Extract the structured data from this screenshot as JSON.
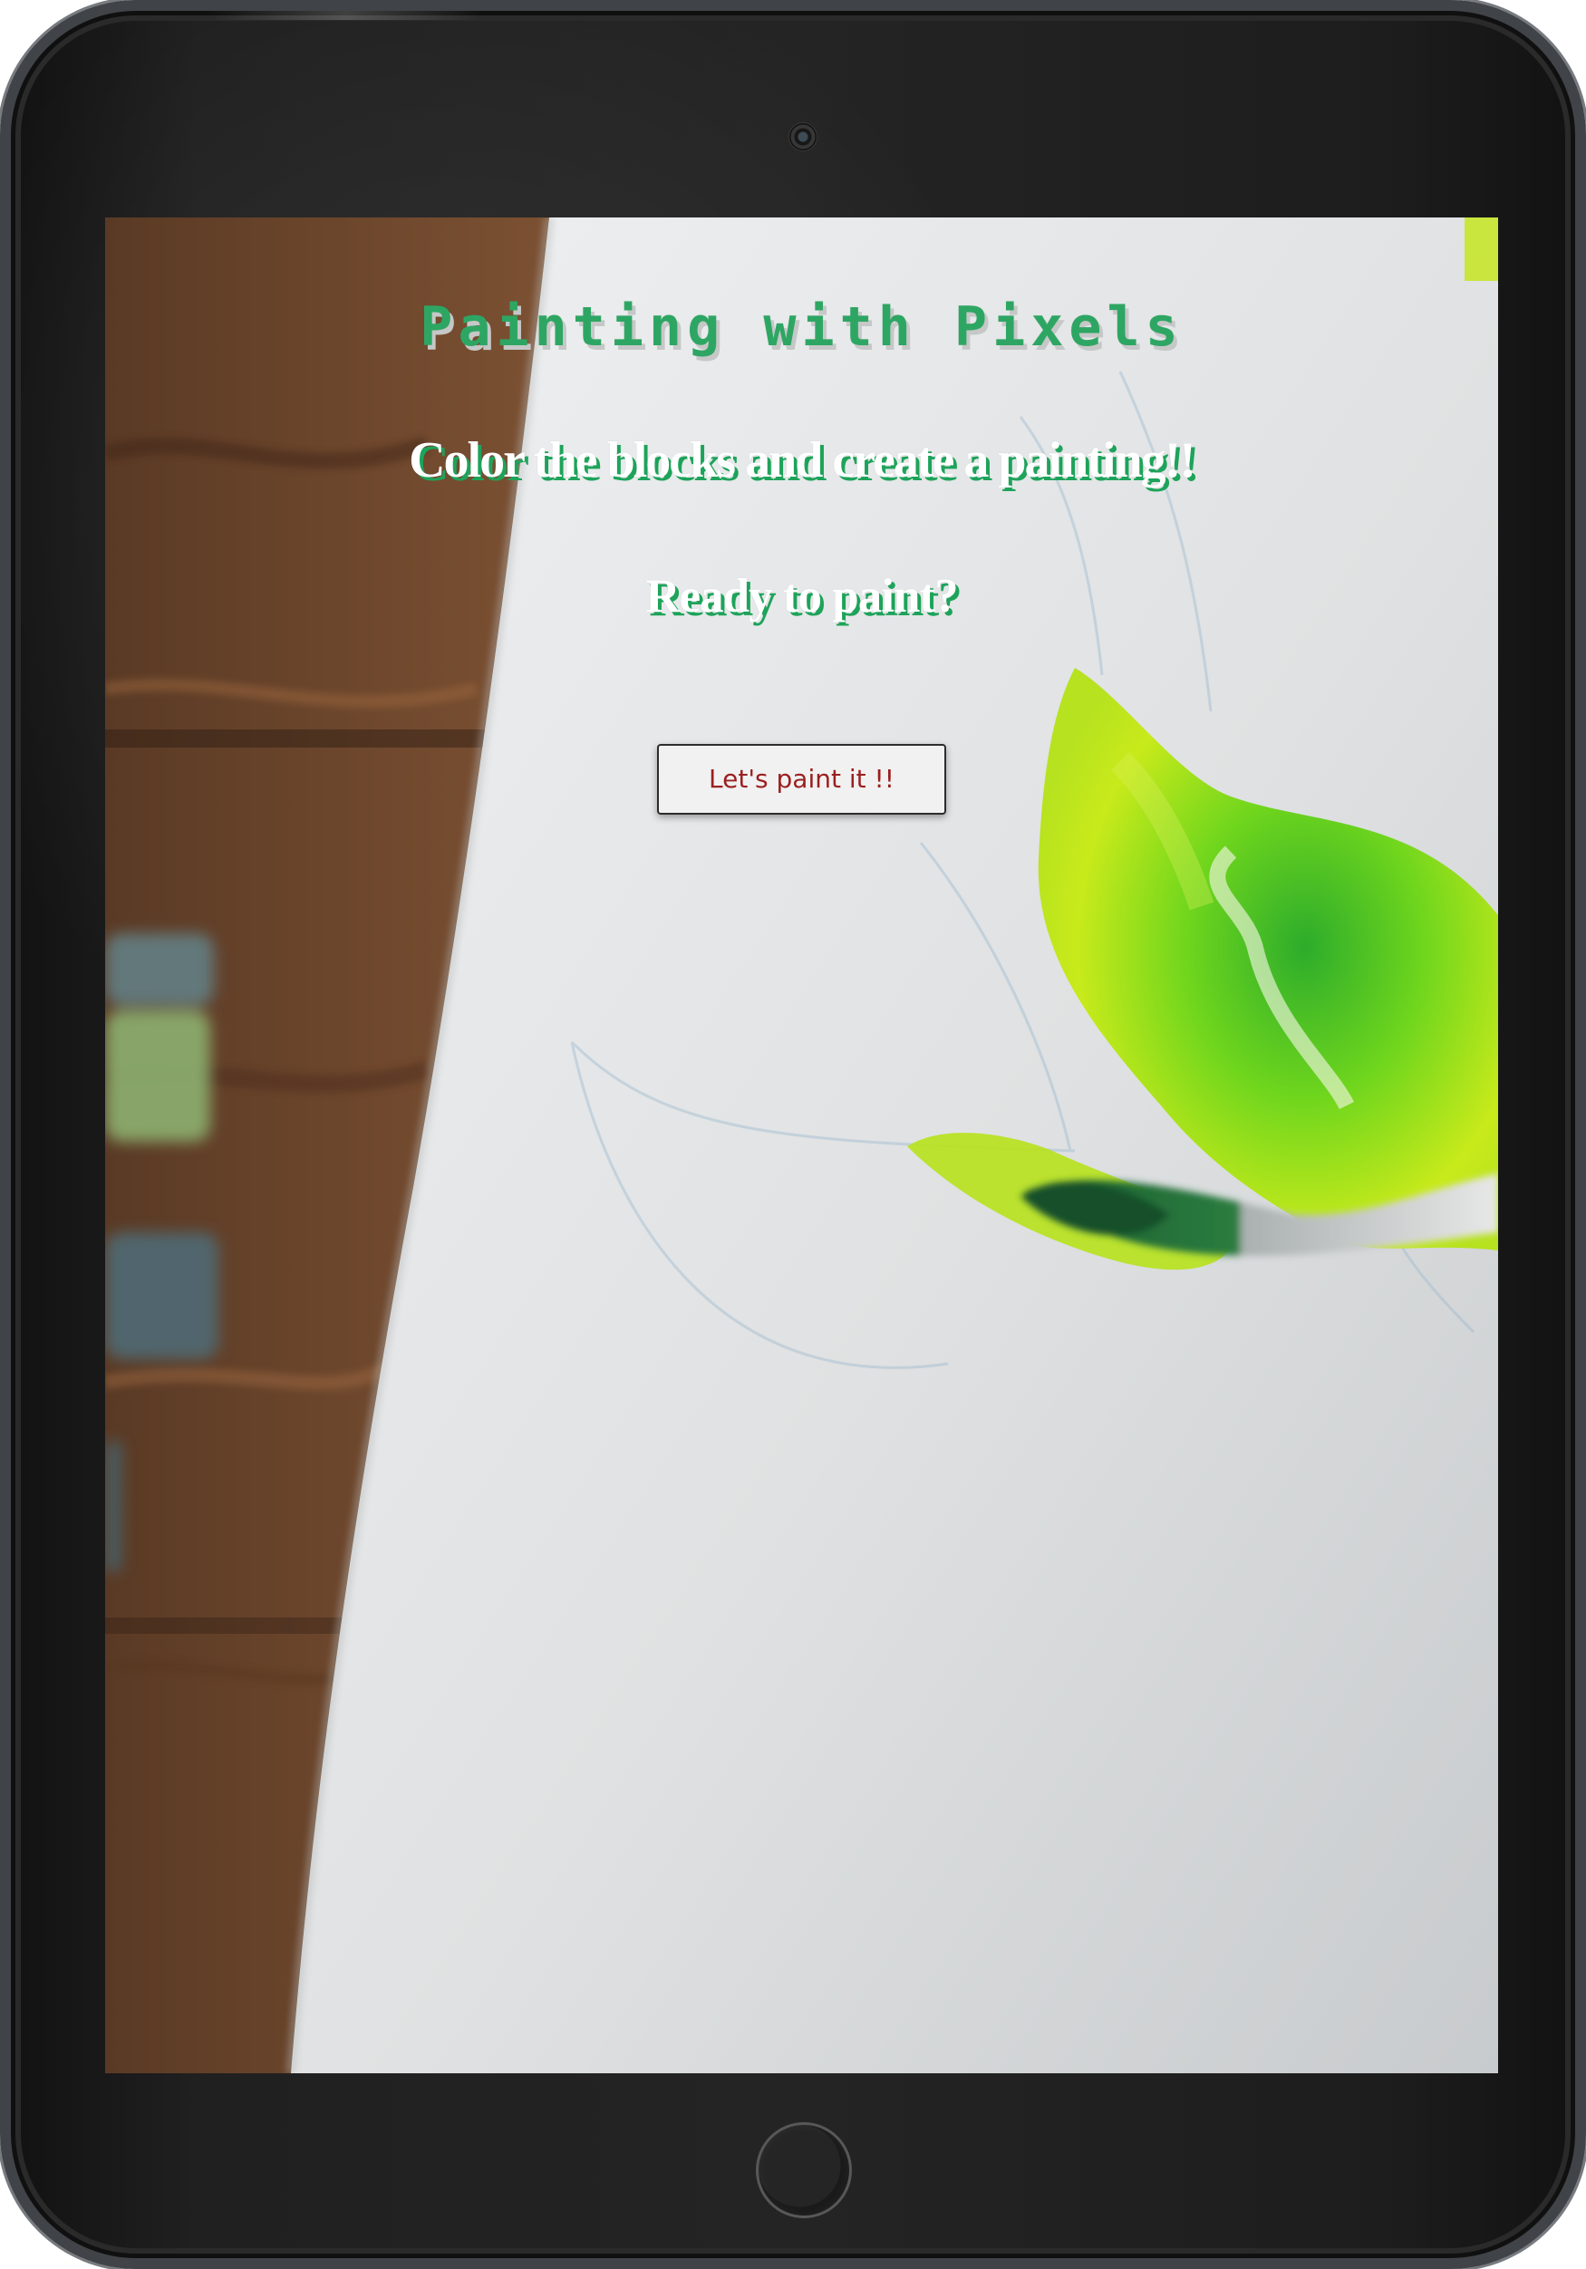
{
  "screen": {
    "title": "Painting with Pixels",
    "subtitle": "Color the blocks and create a painting!!",
    "prompt": "Ready to paint?",
    "start_button_label": "Let's paint it !!"
  },
  "icons": {
    "camera": "camera-icon",
    "home": "home-button-icon"
  },
  "colors": {
    "title": "#2ea663",
    "heading_shadow": "#1ea35a",
    "button_text": "#9b1f1f",
    "leaf_green": "#65c51a"
  }
}
